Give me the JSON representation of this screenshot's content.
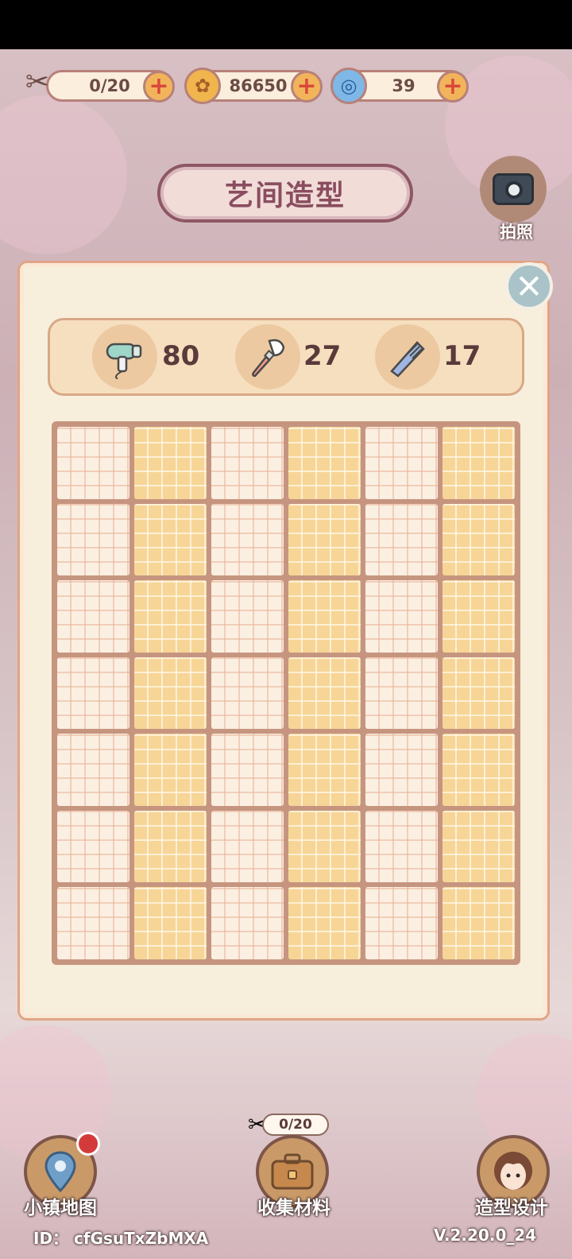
{
  "resources": [
    {
      "name": "scissors",
      "value": "0/20"
    },
    {
      "name": "coins",
      "value": "86650"
    },
    {
      "name": "swirl",
      "value": "39"
    }
  ],
  "plus_symbol": "+",
  "title": "艺间造型",
  "camera": {
    "label": "拍照"
  },
  "close_symbol": "✕",
  "tools": [
    {
      "icon": "hair-dryer-icon",
      "count": "80"
    },
    {
      "icon": "makeup-brush-icon",
      "count": "27"
    },
    {
      "icon": "comb-icon",
      "count": "17"
    }
  ],
  "grid": {
    "columns": 6,
    "rows": 7
  },
  "nav": {
    "map_label": "小镇地图",
    "collect_label": "收集材料",
    "collect_counter": "0/20",
    "design_label": "造型设计"
  },
  "footer": {
    "id_text": "ID：  cfGsuTxZbMXA",
    "version": "V.2.20.0_24"
  },
  "colors": {
    "accent": "#f2b45a",
    "panel": "#f8eedc",
    "title": "#8a4d5f"
  }
}
